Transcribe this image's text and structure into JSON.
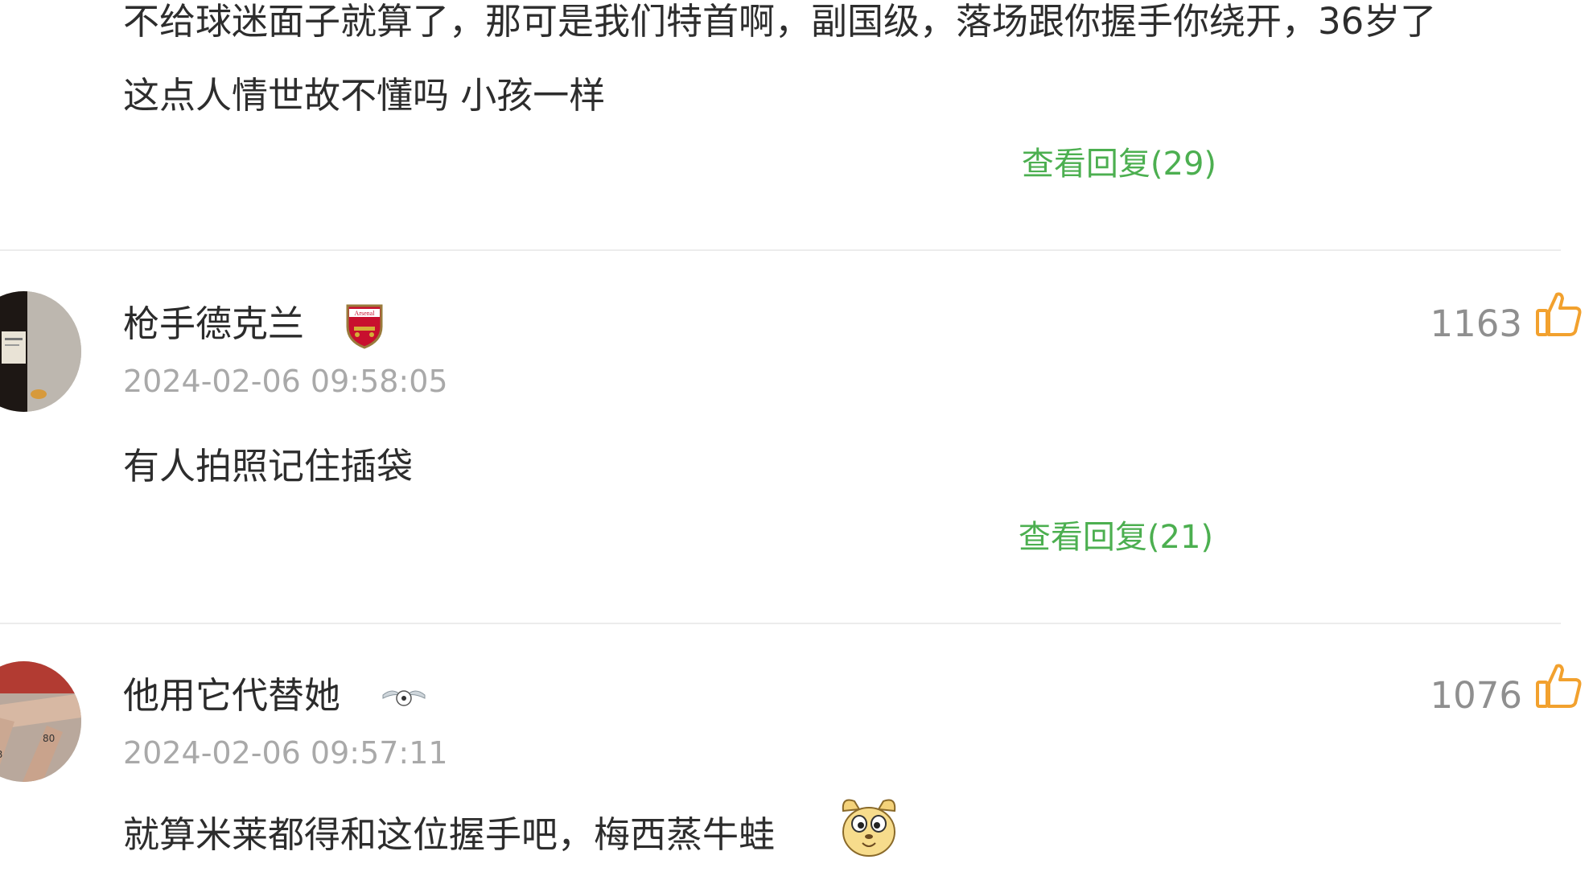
{
  "comments": [
    {
      "text_line1": "不给球迷面子就算了，那可是我们特首啊，副国级，落场跟你握手你绕开，36岁了",
      "text_line2": "这点人情世故不懂吗 小孩一样",
      "replies_label": "查看回复(29)"
    },
    {
      "username": "枪手德克兰",
      "badge": "arsenal-crest",
      "badge_text": "Arsenal",
      "timestamp": "2024-02-06 09:58:05",
      "likes": "1163",
      "text": "有人拍照记住插袋",
      "replies_label": "查看回复(21)"
    },
    {
      "username": "他用它代替她",
      "badge": "winged-football",
      "timestamp": "2024-02-06 09:57:11",
      "likes": "1076",
      "text": "就算米莱都得和这位握手吧，梅西蒸牛蛙"
    }
  ],
  "colors": {
    "accent_green": "#4caf50",
    "like_orange": "#f2a12e",
    "timestamp_gray": "#a9a9a9",
    "divider": "#ececec"
  },
  "icons": {
    "like": "thumbs-up-icon",
    "emoji": "dog-face-emoji"
  }
}
